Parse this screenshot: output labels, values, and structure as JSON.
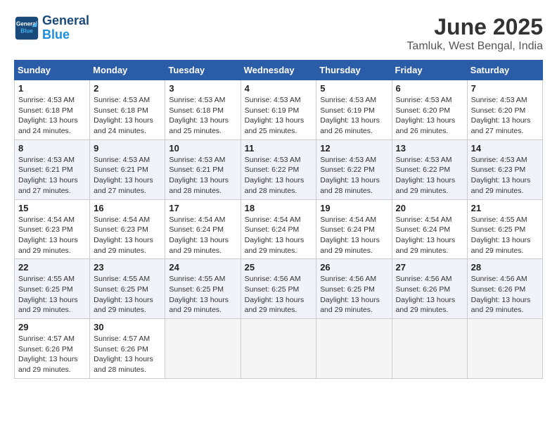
{
  "header": {
    "logo_line1": "General",
    "logo_line2": "Blue",
    "month": "June 2025",
    "location": "Tamluk, West Bengal, India"
  },
  "weekdays": [
    "Sunday",
    "Monday",
    "Tuesday",
    "Wednesday",
    "Thursday",
    "Friday",
    "Saturday"
  ],
  "weeks": [
    [
      {
        "day": "1",
        "info": "Sunrise: 4:53 AM\nSunset: 6:18 PM\nDaylight: 13 hours\nand 24 minutes."
      },
      {
        "day": "2",
        "info": "Sunrise: 4:53 AM\nSunset: 6:18 PM\nDaylight: 13 hours\nand 24 minutes."
      },
      {
        "day": "3",
        "info": "Sunrise: 4:53 AM\nSunset: 6:18 PM\nDaylight: 13 hours\nand 25 minutes."
      },
      {
        "day": "4",
        "info": "Sunrise: 4:53 AM\nSunset: 6:19 PM\nDaylight: 13 hours\nand 25 minutes."
      },
      {
        "day": "5",
        "info": "Sunrise: 4:53 AM\nSunset: 6:19 PM\nDaylight: 13 hours\nand 26 minutes."
      },
      {
        "day": "6",
        "info": "Sunrise: 4:53 AM\nSunset: 6:20 PM\nDaylight: 13 hours\nand 26 minutes."
      },
      {
        "day": "7",
        "info": "Sunrise: 4:53 AM\nSunset: 6:20 PM\nDaylight: 13 hours\nand 27 minutes."
      }
    ],
    [
      {
        "day": "8",
        "info": "Sunrise: 4:53 AM\nSunset: 6:21 PM\nDaylight: 13 hours\nand 27 minutes."
      },
      {
        "day": "9",
        "info": "Sunrise: 4:53 AM\nSunset: 6:21 PM\nDaylight: 13 hours\nand 27 minutes."
      },
      {
        "day": "10",
        "info": "Sunrise: 4:53 AM\nSunset: 6:21 PM\nDaylight: 13 hours\nand 28 minutes."
      },
      {
        "day": "11",
        "info": "Sunrise: 4:53 AM\nSunset: 6:22 PM\nDaylight: 13 hours\nand 28 minutes."
      },
      {
        "day": "12",
        "info": "Sunrise: 4:53 AM\nSunset: 6:22 PM\nDaylight: 13 hours\nand 28 minutes."
      },
      {
        "day": "13",
        "info": "Sunrise: 4:53 AM\nSunset: 6:22 PM\nDaylight: 13 hours\nand 29 minutes."
      },
      {
        "day": "14",
        "info": "Sunrise: 4:53 AM\nSunset: 6:23 PM\nDaylight: 13 hours\nand 29 minutes."
      }
    ],
    [
      {
        "day": "15",
        "info": "Sunrise: 4:54 AM\nSunset: 6:23 PM\nDaylight: 13 hours\nand 29 minutes."
      },
      {
        "day": "16",
        "info": "Sunrise: 4:54 AM\nSunset: 6:23 PM\nDaylight: 13 hours\nand 29 minutes."
      },
      {
        "day": "17",
        "info": "Sunrise: 4:54 AM\nSunset: 6:24 PM\nDaylight: 13 hours\nand 29 minutes."
      },
      {
        "day": "18",
        "info": "Sunrise: 4:54 AM\nSunset: 6:24 PM\nDaylight: 13 hours\nand 29 minutes."
      },
      {
        "day": "19",
        "info": "Sunrise: 4:54 AM\nSunset: 6:24 PM\nDaylight: 13 hours\nand 29 minutes."
      },
      {
        "day": "20",
        "info": "Sunrise: 4:54 AM\nSunset: 6:24 PM\nDaylight: 13 hours\nand 29 minutes."
      },
      {
        "day": "21",
        "info": "Sunrise: 4:55 AM\nSunset: 6:25 PM\nDaylight: 13 hours\nand 29 minutes."
      }
    ],
    [
      {
        "day": "22",
        "info": "Sunrise: 4:55 AM\nSunset: 6:25 PM\nDaylight: 13 hours\nand 29 minutes."
      },
      {
        "day": "23",
        "info": "Sunrise: 4:55 AM\nSunset: 6:25 PM\nDaylight: 13 hours\nand 29 minutes."
      },
      {
        "day": "24",
        "info": "Sunrise: 4:55 AM\nSunset: 6:25 PM\nDaylight: 13 hours\nand 29 minutes."
      },
      {
        "day": "25",
        "info": "Sunrise: 4:56 AM\nSunset: 6:25 PM\nDaylight: 13 hours\nand 29 minutes."
      },
      {
        "day": "26",
        "info": "Sunrise: 4:56 AM\nSunset: 6:25 PM\nDaylight: 13 hours\nand 29 minutes."
      },
      {
        "day": "27",
        "info": "Sunrise: 4:56 AM\nSunset: 6:26 PM\nDaylight: 13 hours\nand 29 minutes."
      },
      {
        "day": "28",
        "info": "Sunrise: 4:56 AM\nSunset: 6:26 PM\nDaylight: 13 hours\nand 29 minutes."
      }
    ],
    [
      {
        "day": "29",
        "info": "Sunrise: 4:57 AM\nSunset: 6:26 PM\nDaylight: 13 hours\nand 29 minutes."
      },
      {
        "day": "30",
        "info": "Sunrise: 4:57 AM\nSunset: 6:26 PM\nDaylight: 13 hours\nand 28 minutes."
      },
      {
        "day": "",
        "info": ""
      },
      {
        "day": "",
        "info": ""
      },
      {
        "day": "",
        "info": ""
      },
      {
        "day": "",
        "info": ""
      },
      {
        "day": "",
        "info": ""
      }
    ]
  ]
}
